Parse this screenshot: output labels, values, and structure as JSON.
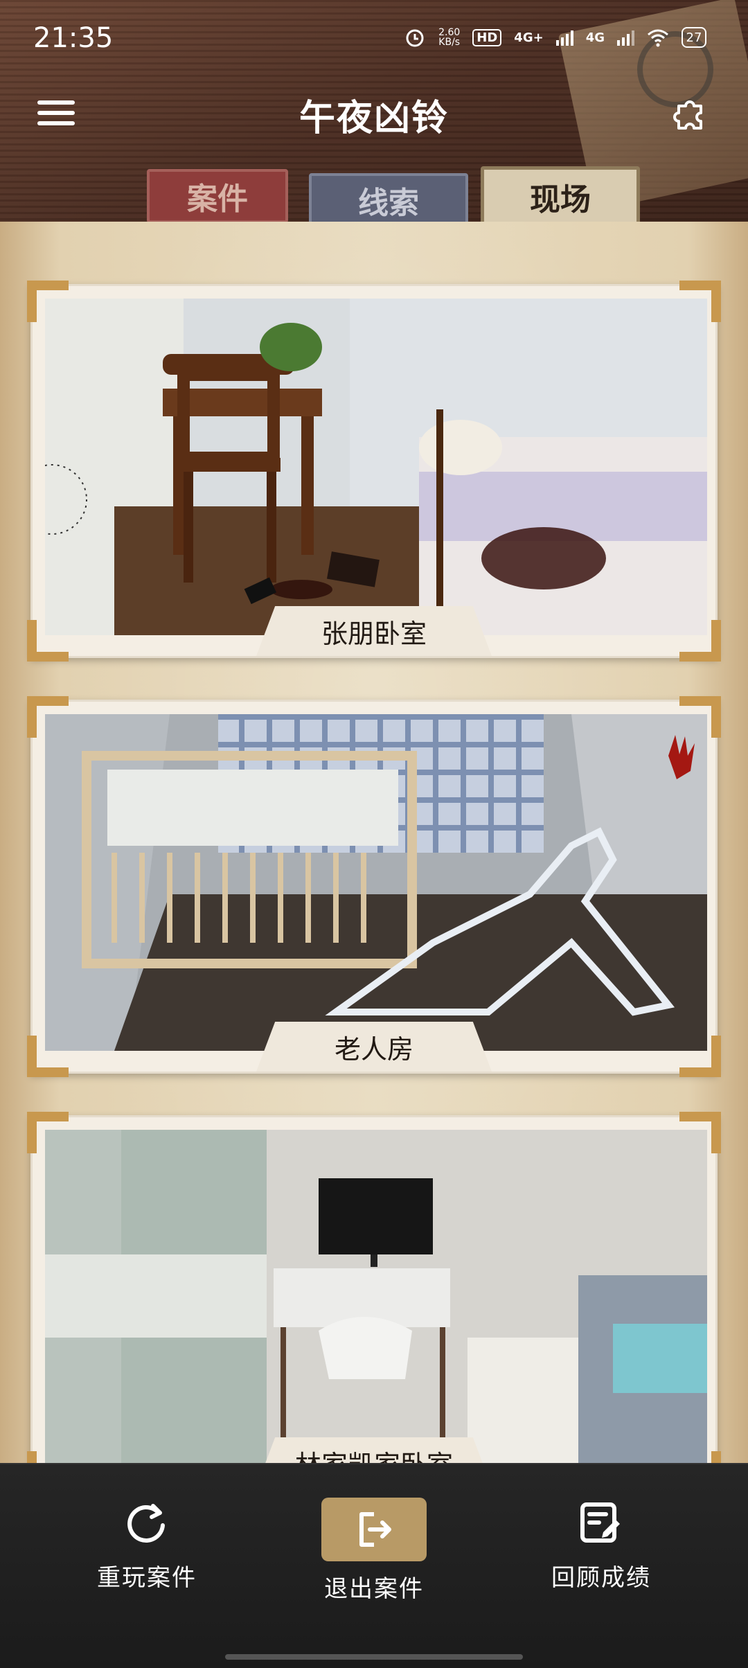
{
  "status": {
    "time": "21:35",
    "net_speed": "2.60\nKB/s",
    "hd": "HD",
    "sig1": "4G+",
    "sig2": "4G",
    "battery": "27"
  },
  "header": {
    "title": "午夜凶铃"
  },
  "tabs": [
    {
      "label": "案件"
    },
    {
      "label": "线索"
    },
    {
      "label": "现场"
    }
  ],
  "scenes": [
    {
      "label": "张朋卧室"
    },
    {
      "label": "老人房"
    },
    {
      "label": "林家凯家卧室"
    }
  ],
  "bottom": {
    "replay": "重玩案件",
    "exit": "退出案件",
    "review": "回顾成绩"
  },
  "colors": {
    "accent": "#b89a66",
    "tab_case": "#8e3d3b",
    "tab_clue": "#5b6075",
    "tab_scene": "#d9ccb1"
  }
}
